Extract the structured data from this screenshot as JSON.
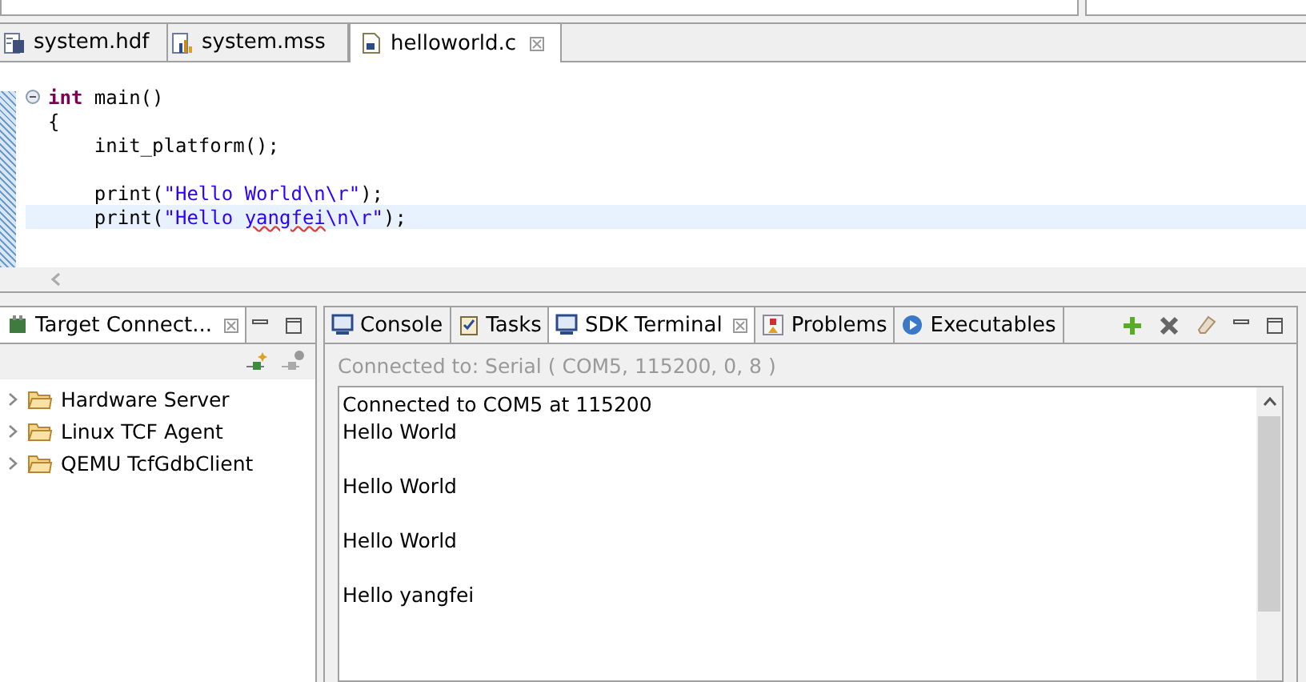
{
  "editor": {
    "tabs": [
      {
        "label": "system.hdf",
        "selected": false
      },
      {
        "label": "system.mss",
        "selected": false
      },
      {
        "label": "helloworld.c",
        "selected": true
      }
    ],
    "lines": [
      {
        "kind": "code",
        "fold": true,
        "current": false,
        "tokens": [
          {
            "kind": "keyword",
            "text": "int"
          },
          {
            "kind": "plain",
            "text": " main()"
          }
        ]
      },
      {
        "kind": "code",
        "fold": false,
        "current": false,
        "tokens": [
          {
            "kind": "plain",
            "text": "{"
          }
        ]
      },
      {
        "kind": "code",
        "fold": false,
        "current": false,
        "tokens": [
          {
            "kind": "plain",
            "text": "    init_platform();"
          }
        ]
      },
      {
        "kind": "blank"
      },
      {
        "kind": "code",
        "fold": false,
        "current": false,
        "tokens": [
          {
            "kind": "plain",
            "text": "    print("
          },
          {
            "kind": "string",
            "text": "\"Hello World\\n\\r\""
          },
          {
            "kind": "plain",
            "text": ");"
          }
        ]
      },
      {
        "kind": "code",
        "fold": false,
        "current": true,
        "tokens": [
          {
            "kind": "plain",
            "text": "    print("
          },
          {
            "kind": "string",
            "text": "\"Hello "
          },
          {
            "kind": "misspelled",
            "text": "yangfei"
          },
          {
            "kind": "string",
            "text": "\\n\\r\""
          },
          {
            "kind": "plain",
            "text": ");"
          }
        ]
      }
    ]
  },
  "target_panel": {
    "tab": {
      "label": "Target Connect...",
      "selected": true
    },
    "items": [
      {
        "label": "Hardware Server",
        "expanded": false
      },
      {
        "label": "Linux TCF Agent",
        "expanded": false
      },
      {
        "label": "QEMU TcfGdbClient",
        "expanded": false
      }
    ]
  },
  "console_panel": {
    "tabs": [
      {
        "label": "Console",
        "selected": false
      },
      {
        "label": "Tasks",
        "selected": false
      },
      {
        "label": "SDK Terminal",
        "selected": true
      },
      {
        "label": "Problems",
        "selected": false
      },
      {
        "label": "Executables",
        "selected": false
      }
    ],
    "status": "Connected to: Serial (  COM5, 115200, 0, 8 )",
    "output": [
      {
        "kind": "text",
        "text": "Connected to COM5 at 115200"
      },
      {
        "kind": "text",
        "text": "Hello World"
      },
      {
        "kind": "blank"
      },
      {
        "kind": "text",
        "text": "Hello World"
      },
      {
        "kind": "blank"
      },
      {
        "kind": "text",
        "text": "Hello World"
      },
      {
        "kind": "blank"
      },
      {
        "kind": "text",
        "text": "Hello yangfei"
      }
    ]
  }
}
